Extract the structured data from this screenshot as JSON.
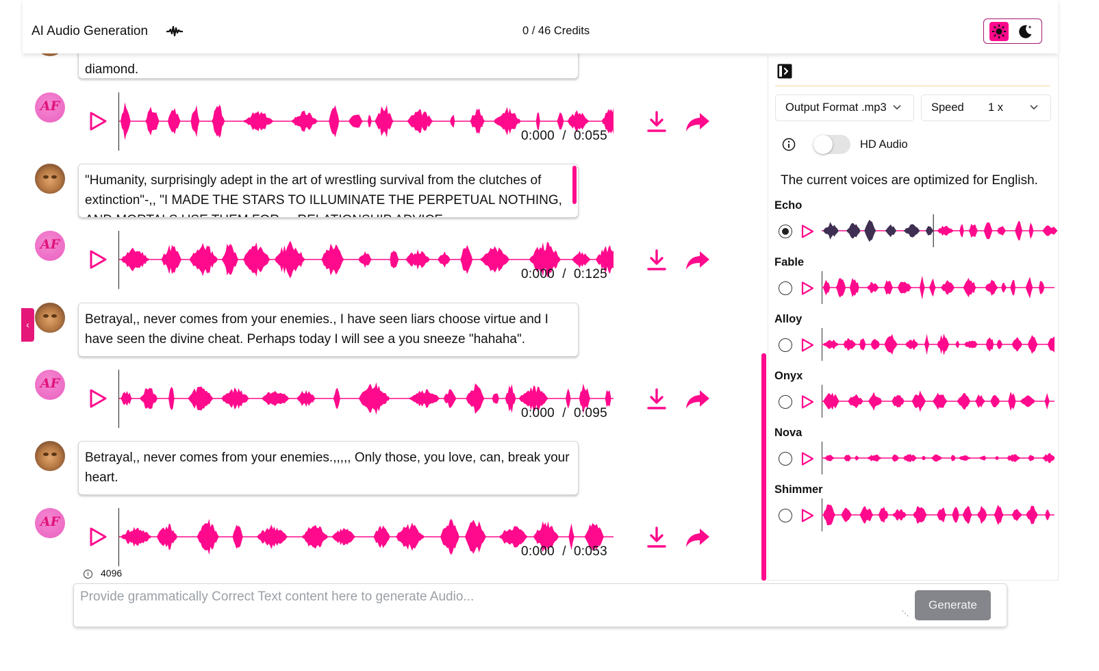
{
  "header": {
    "title": "AI Audio Generation",
    "credits": "0 / 46 Credits"
  },
  "colors": {
    "accent": "#ff0a8c",
    "played_wave": "#3f2f52",
    "generate_disabled": "#85868b"
  },
  "chat": {
    "messages": [
      {
        "type": "user",
        "text": "diamond."
      },
      {
        "type": "audio",
        "time": "0:000  /  0:055"
      },
      {
        "type": "user",
        "text": "\"Humanity, surprisingly adept in the art of wrestling survival from the clutches of extinction\"-,, \"I MADE THE STARS TO ILLUMINATE THE PERPETUAL NOTHING, AND MORTALS USE THEM FOR ... RELATIONSHIP ADVICE"
      },
      {
        "type": "audio",
        "time": "0:000  /  0:125"
      },
      {
        "type": "user",
        "text": "Betrayal,, never comes from your enemies., I have seen liars choose virtue and I have seen the divine cheat. Perhaps today I will see a you sneeze \"hahaha\"."
      },
      {
        "type": "audio",
        "time": "0:000  /  0:095"
      },
      {
        "type": "user",
        "text": "Betrayal,, never comes from your enemies.,,,,, Only those, you love, can, break your heart."
      },
      {
        "type": "audio",
        "time": "0:000  /  0:053"
      }
    ],
    "avatar_initials": "AF"
  },
  "composer": {
    "char_limit": "4096",
    "placeholder": "Provide grammatically Correct Text content here to generate Audio...",
    "generate_label": "Generate"
  },
  "panel": {
    "output_format": "Output Format .mp3",
    "speed_label": "Speed",
    "speed_value": "1 x",
    "hd_label": "HD Audio",
    "hd_enabled": false,
    "voices_note": "The current voices are optimized for English.",
    "voices": [
      {
        "name": "Echo",
        "selected": true
      },
      {
        "name": "Fable",
        "selected": false
      },
      {
        "name": "Alloy",
        "selected": false
      },
      {
        "name": "Onyx",
        "selected": false
      },
      {
        "name": "Nova",
        "selected": false
      },
      {
        "name": "Shimmer",
        "selected": false
      }
    ]
  }
}
